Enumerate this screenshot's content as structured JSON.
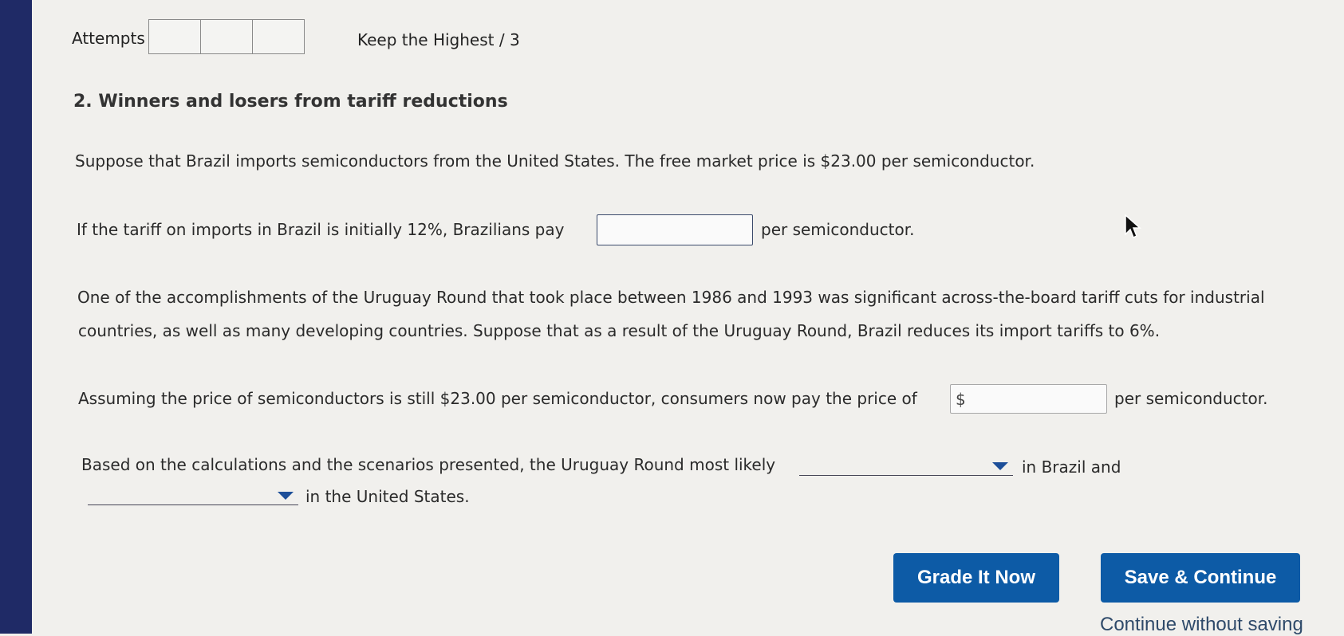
{
  "header": {
    "attempts_label": "Attempts",
    "keep_label": "Keep the Highest / 3"
  },
  "question": {
    "title": "2. Winners and losers from tariff reductions",
    "intro": "Suppose that Brazil imports semiconductors from the United States. The free market price is $23.00 per semiconductor.",
    "tariff_prefix": "If the tariff on imports in Brazil is initially 12%, Brazilians pay",
    "tariff_suffix": "per semiconductor.",
    "uruguay_line1": "One of the accomplishments of the Uruguay Round that took place between 1986 and 1993 was significant across-the-board tariff cuts for industrial",
    "uruguay_line2": "countries, as well as many developing countries. Suppose that as a result of the Uruguay Round, Brazil reduces its import tariffs to 6%.",
    "assume_prefix": "Assuming the price of semiconductors is still $23.00 per semiconductor, consumers now pay the price of",
    "currency_symbol": "$",
    "assume_suffix": "per semiconductor.",
    "based_prefix": "Based on the calculations and the scenarios presented, the Uruguay Round most likely",
    "based_mid": "in Brazil and",
    "based_suffix": "in the United States."
  },
  "inputs": {
    "price_initial_value": "",
    "price_after_value": "",
    "dropdown_brazil_selected": "",
    "dropdown_us_selected": ""
  },
  "actions": {
    "grade_label": "Grade It Now",
    "save_label": "Save & Continue",
    "continue_label": "Continue without saving"
  },
  "colors": {
    "button_blue": "#0d5ba6",
    "sidebar_navy": "#1f2a66"
  }
}
